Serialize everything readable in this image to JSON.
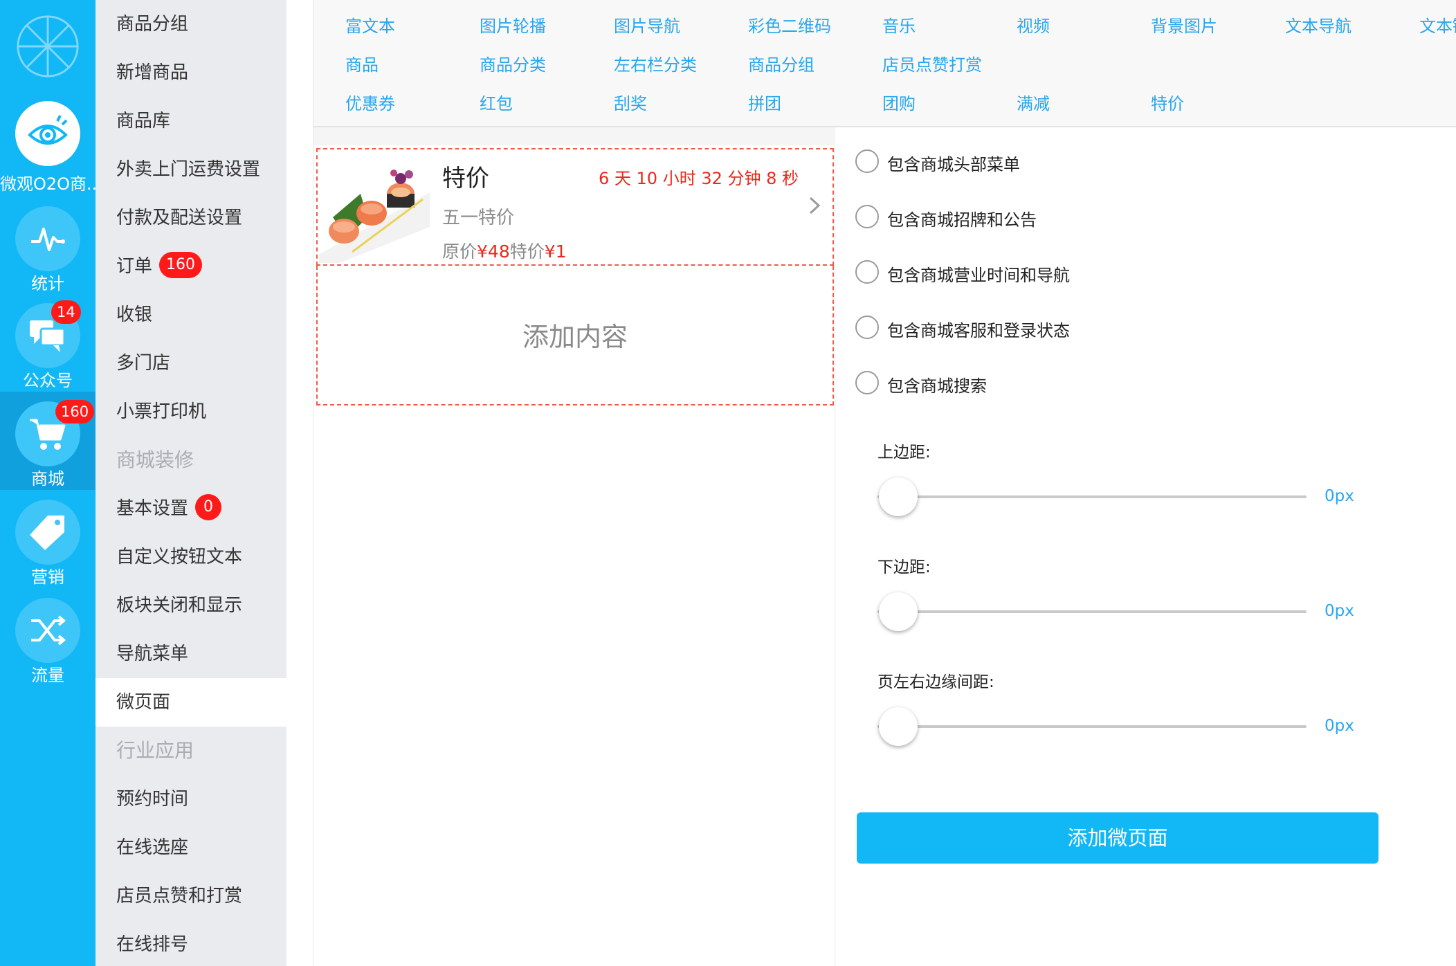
{
  "rail": {
    "items": [
      {
        "label": "微观O2O商...",
        "icon": "eye-icon"
      },
      {
        "label": "统计",
        "icon": "pulse-icon"
      },
      {
        "label": "公众号",
        "icon": "chat-icon",
        "badge": "14"
      },
      {
        "label": "商城",
        "icon": "cart-icon",
        "badge": "160"
      },
      {
        "label": "营销",
        "icon": "tag-icon"
      },
      {
        "label": "流量",
        "icon": "shuffle-icon"
      }
    ]
  },
  "menu": {
    "items": [
      {
        "label": "商品分组"
      },
      {
        "label": "新增商品"
      },
      {
        "label": "商品库"
      },
      {
        "label": "外卖上门运费设置"
      },
      {
        "label": "付款及配送设置"
      },
      {
        "label": "订单",
        "badge": "160"
      },
      {
        "label": "收银"
      },
      {
        "label": "多门店"
      },
      {
        "label": "小票打印机"
      },
      {
        "label": "商城装修"
      },
      {
        "label": "基本设置",
        "badge": "0"
      },
      {
        "label": "自定义按钮文本"
      },
      {
        "label": "板块关闭和显示"
      },
      {
        "label": "导航菜单"
      },
      {
        "label": "微页面"
      },
      {
        "label": "行业应用"
      },
      {
        "label": "预约时间"
      },
      {
        "label": "在线选座"
      },
      {
        "label": "店员点赞和打赏"
      },
      {
        "label": "在线排号"
      }
    ]
  },
  "components": {
    "row1": [
      "富文本",
      "图片轮播",
      "图片导航",
      "彩色二维码",
      "音乐",
      "视频",
      "背景图片",
      "文本导航",
      "文本链"
    ],
    "row2": [
      "商品",
      "商品分类",
      "左右栏分类",
      "商品分组",
      "店员点赞打赏"
    ],
    "row3": [
      "优惠券",
      "红包",
      "刮奖",
      "拼团",
      "团购",
      "满减",
      "特价"
    ]
  },
  "product": {
    "title": "特价",
    "countdown": "6 天 10 小时 32 分钟 8 秒",
    "subtitle": "五一特价",
    "orig_label": "原价",
    "orig_price": "¥48",
    "sale_label": "特价",
    "sale_price": "¥1"
  },
  "add_content": "添加内容",
  "options": [
    "包含商城头部菜单",
    "包含商城招牌和公告",
    "包含商城营业时间和导航",
    "包含商城客服和登录状态",
    "包含商城搜索"
  ],
  "sliders": [
    {
      "label": "上边距:",
      "value": "0px"
    },
    {
      "label": "下边距:",
      "value": "0px"
    },
    {
      "label": "页左右边缘间距:",
      "value": "0px"
    }
  ],
  "add_page_button": "添加微页面",
  "colors": {
    "accent": "#12b7f5",
    "badge": "#ff1a1a",
    "link": "#27a7ee",
    "countdown": "#e8291b"
  }
}
